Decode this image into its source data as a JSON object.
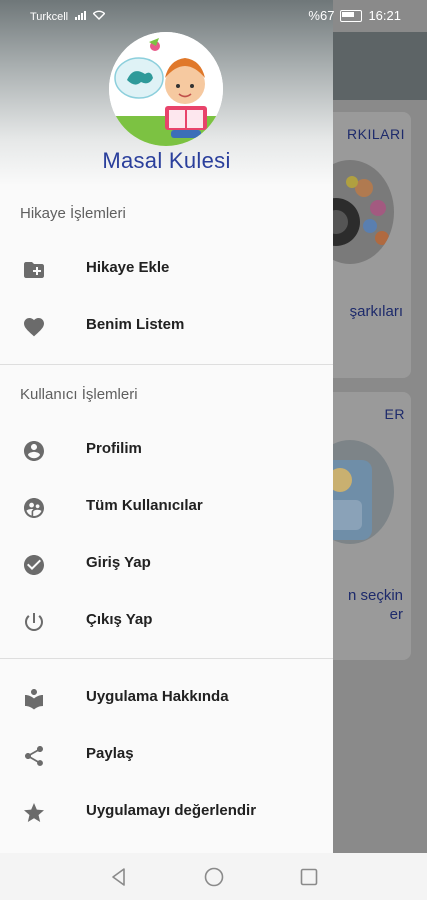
{
  "status_bar": {
    "carrier": "Turkcell",
    "battery": "%67",
    "time": "16:21"
  },
  "background": {
    "card1": {
      "title": "RKILARI",
      "text": "şarkıları"
    },
    "card2": {
      "title": "ER",
      "text_line1": "n seçkin",
      "text_line2": "er"
    }
  },
  "drawer": {
    "app_name": "Masal Kulesi",
    "sections": [
      {
        "title": "Hikaye İşlemleri",
        "items": [
          {
            "label": "Hikaye Ekle",
            "icon": "folder-add-icon"
          },
          {
            "label": "Benim Listem",
            "icon": "heart-icon"
          }
        ]
      },
      {
        "title": "Kullanıcı İşlemleri",
        "items": [
          {
            "label": "Profilim",
            "icon": "account-circle-icon"
          },
          {
            "label": "Tüm Kullanıcılar",
            "icon": "users-icon"
          },
          {
            "label": "Giriş Yap",
            "icon": "check-circle-icon"
          },
          {
            "label": "Çıkış Yap",
            "icon": "power-icon"
          }
        ]
      },
      {
        "title": "",
        "items": [
          {
            "label": "Uygulama Hakkında",
            "icon": "reader-icon"
          },
          {
            "label": "Paylaş",
            "icon": "share-icon"
          },
          {
            "label": "Uygulamayı değerlendir",
            "icon": "star-icon"
          }
        ]
      }
    ]
  },
  "colors": {
    "accent": "#2a3f9c",
    "icon": "#6b6b6b",
    "scrim": "#8a8a8a"
  }
}
